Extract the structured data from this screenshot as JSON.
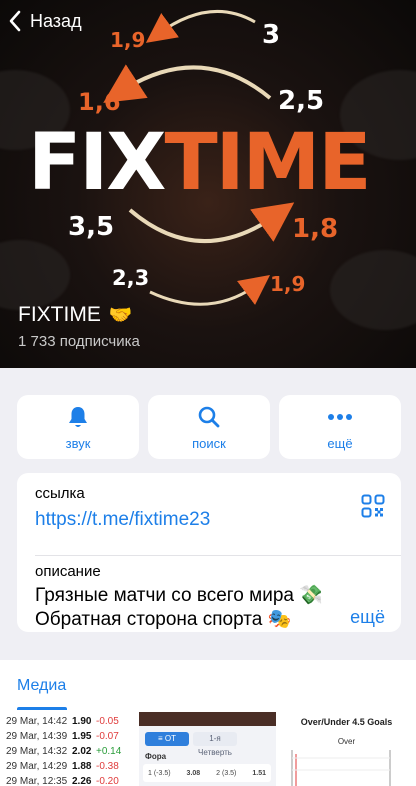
{
  "nav": {
    "back_label": "Назад"
  },
  "hero": {
    "logo_part1": "FIX",
    "logo_part2": "TIME",
    "odds": [
      {
        "text": "3"
      },
      {
        "text": "1,9"
      },
      {
        "text": "2,5"
      },
      {
        "text": "1,6"
      },
      {
        "text": "3,5"
      },
      {
        "text": "1,8"
      },
      {
        "text": "2,3"
      },
      {
        "text": "1,9"
      }
    ],
    "brand_color": "#e8642a"
  },
  "channel": {
    "name": "FIXTIME",
    "name_emoji": "🤝",
    "subscribers": "1 733 подписчика"
  },
  "actions": [
    {
      "label": "звук",
      "icon": "bell-icon"
    },
    {
      "label": "поиск",
      "icon": "search-icon"
    },
    {
      "label": "ещё",
      "icon": "more-dots-icon"
    }
  ],
  "info": {
    "link_label": "ссылка",
    "link_value": "https://t.me/fixtime23",
    "description_label": "описание",
    "description_line1": "Грязные матчи со всего мира 💸",
    "description_line2": "Обратная сторона спорта 🎭",
    "more_label": "ещё"
  },
  "tabs": {
    "media_label": "Медиа"
  },
  "media": {
    "table_rows": [
      {
        "date": "29 Mar, 14:42",
        "odd": "1.90",
        "change": "-0.05",
        "change_color": "#e03b3b"
      },
      {
        "date": "29 Mar, 14:39",
        "odd": "1.95",
        "change": "-0.07",
        "change_color": "#e03b3b"
      },
      {
        "date": "29 Mar, 14:32",
        "odd": "2.02",
        "change": "+0.14",
        "change_color": "#2a9d3a"
      },
      {
        "date": "29 Mar, 14:29",
        "odd": "1.88",
        "change": "-0.38",
        "change_color": "#e03b3b"
      },
      {
        "date": "29 Mar, 12:35",
        "odd": "2.26",
        "change": "-0.20",
        "change_color": "#e03b3b"
      }
    ],
    "tile2": {
      "tab1": "≡ ОТ",
      "tab2": "1-я Четверть",
      "label": "Фора",
      "row_left": "1 (-3.5)",
      "row_mid": "3.08",
      "row_right_label": "2 (3.5)",
      "row_right": "1.51"
    },
    "tile3": {
      "title": "Over/Under 4.5 Goals",
      "subtitle": "Over"
    }
  },
  "colors": {
    "accent": "#1d7fe8",
    "background": "#efeff4"
  }
}
